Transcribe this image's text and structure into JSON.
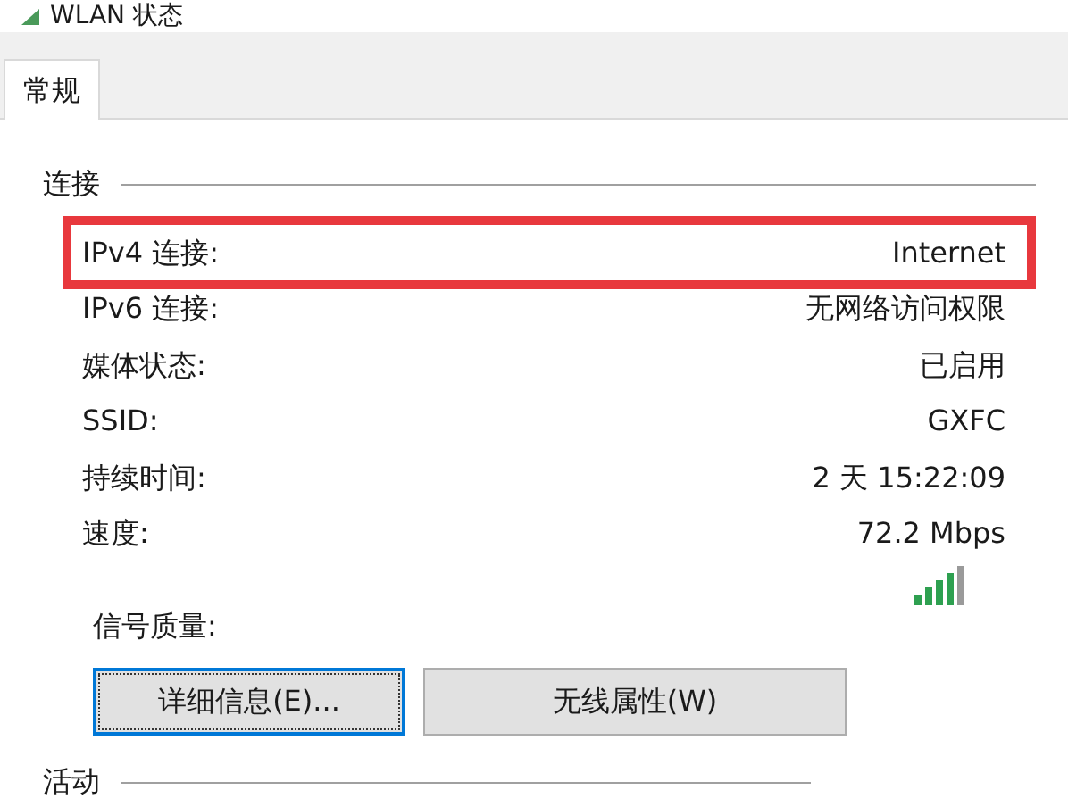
{
  "window": {
    "title": "WLAN 状态"
  },
  "tabs": [
    {
      "label": "常规",
      "selected": true
    }
  ],
  "connection": {
    "heading": "连接",
    "rows": [
      {
        "label": "IPv4 连接:",
        "value": "Internet",
        "highlighted": true
      },
      {
        "label": "IPv6 连接:",
        "value": "无网络访问权限",
        "highlighted": false
      },
      {
        "label": "媒体状态:",
        "value": "已启用",
        "highlighted": false
      },
      {
        "label": "SSID:",
        "value": "GXFC",
        "highlighted": false
      },
      {
        "label": "持续时间:",
        "value": "2 天 15:22:09",
        "highlighted": false
      },
      {
        "label": "速度:",
        "value": "72.2 Mbps",
        "highlighted": false
      }
    ],
    "signal_label": "信号质量:"
  },
  "buttons": [
    {
      "label": "详细信息(E)...",
      "focused": true
    },
    {
      "label": "无线属性(W)",
      "focused": false
    }
  ],
  "activity": {
    "heading": "活动"
  }
}
